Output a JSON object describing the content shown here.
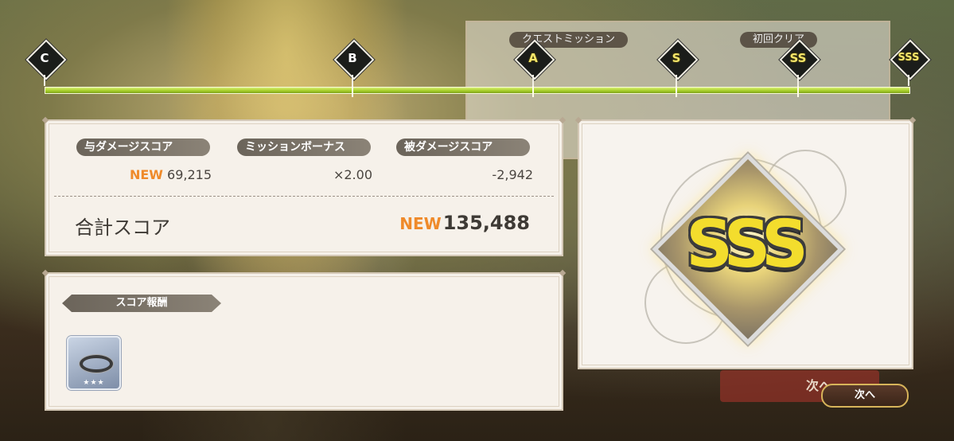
{
  "background": {
    "mission_tabs": [
      "クエストミッション",
      "初回クリア"
    ],
    "next_label": "次へ"
  },
  "rank_bar": {
    "ranks": [
      {
        "label": "C",
        "gold": false
      },
      {
        "label": "B",
        "gold": false
      },
      {
        "label": "A",
        "gold": true
      },
      {
        "label": "S",
        "gold": true
      },
      {
        "label": "SS",
        "gold": true
      },
      {
        "label": "SSS",
        "gold": true
      }
    ],
    "colors": {
      "bar": "#a8cf2a",
      "marker": "#1b1d1a",
      "gold_text": "#f5e66a"
    }
  },
  "score": {
    "damage_dealt_label": "与ダメージスコア",
    "mission_bonus_label": "ミッションボーナス",
    "damage_taken_label": "被ダメージスコア",
    "new_tag": "NEW",
    "damage_dealt_value": "69,215",
    "mission_bonus_value": "×2.00",
    "damage_taken_value": "-2,942",
    "total_label": "合計スコア",
    "total_value": "135,488"
  },
  "reward": {
    "title": "スコア報酬",
    "item_icon": "ring-icon",
    "item_stars": "★★★"
  },
  "rank_result": {
    "rank": "SSS"
  },
  "next_button": {
    "label": "次へ"
  },
  "colors": {
    "new_orange": "#ef8a2a",
    "panel_bg": "#f6f1ea",
    "pill_bg": "#7b7468"
  }
}
